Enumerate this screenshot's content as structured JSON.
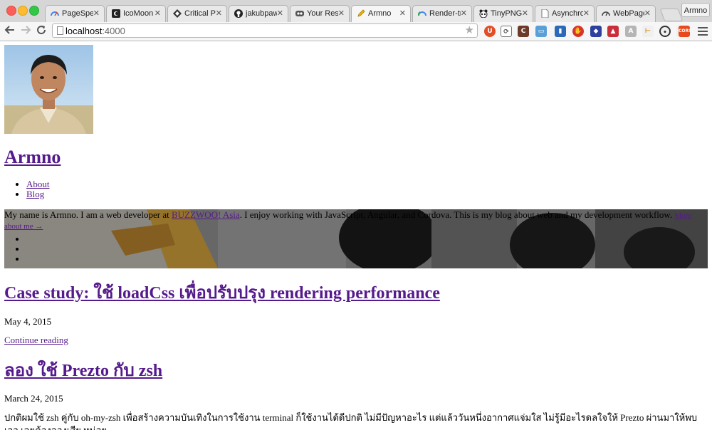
{
  "browser": {
    "tabs": [
      {
        "title": "PageSpeed",
        "icon": "pagespeed-icon"
      },
      {
        "title": "IcoMoon A",
        "icon": "icomoon-icon"
      },
      {
        "title": "Critical Pat",
        "icon": "critical-path-icon"
      },
      {
        "title": "jakubpawlo",
        "icon": "github-icon"
      },
      {
        "title": "Your Result",
        "icon": "webpagetest-icon"
      },
      {
        "title": "Armno",
        "icon": "pencil-icon"
      },
      {
        "title": "Render-tree",
        "icon": "google-dev-icon"
      },
      {
        "title": "TinyPNG –",
        "icon": "panda-icon"
      },
      {
        "title": "Asynchrono",
        "icon": "page-icon"
      },
      {
        "title": "WebPagete",
        "icon": "speedometer-icon"
      }
    ],
    "profile_label": "Armno",
    "url_host": "localhost",
    "url_port": ":4000"
  },
  "site": {
    "title": "Armno",
    "nav": [
      "About",
      "Blog"
    ]
  },
  "hero": {
    "text_before": "My name is Armno. I am a web developer at ",
    "employer_link": "BUZZWOO! Asia",
    "text_after": ". I enjoy working with JavaScript, Angular, and Cordova. This is my blog about web and my development workflow. ",
    "more_link": "More about me",
    "more_link_tail": "→"
  },
  "posts": [
    {
      "title": "Case study: ใช้ loadCss เพื่อปรับปรุง rendering performance",
      "date": "May 4, 2015",
      "continue_label": "Continue reading"
    },
    {
      "title": "ลอง ใช้ Prezto กับ zsh",
      "date": "March 24, 2015",
      "excerpt": "ปกติผมใช้ zsh คู่กับ oh-my-zsh เพื่อสร้างความบันเทิงในการใช้งาน terminal ก็ใช้งานได้ดีปกติ ไม่มีปัญหาอะไร แต่แล้ววันหนึ่งอากาศแจ่มใส ไม่รู้มีอะไรดลใจให้ Prezto ผ่านมาให้พบเจอ เลยต้องลองเสีย หน่อย"
    }
  ]
}
